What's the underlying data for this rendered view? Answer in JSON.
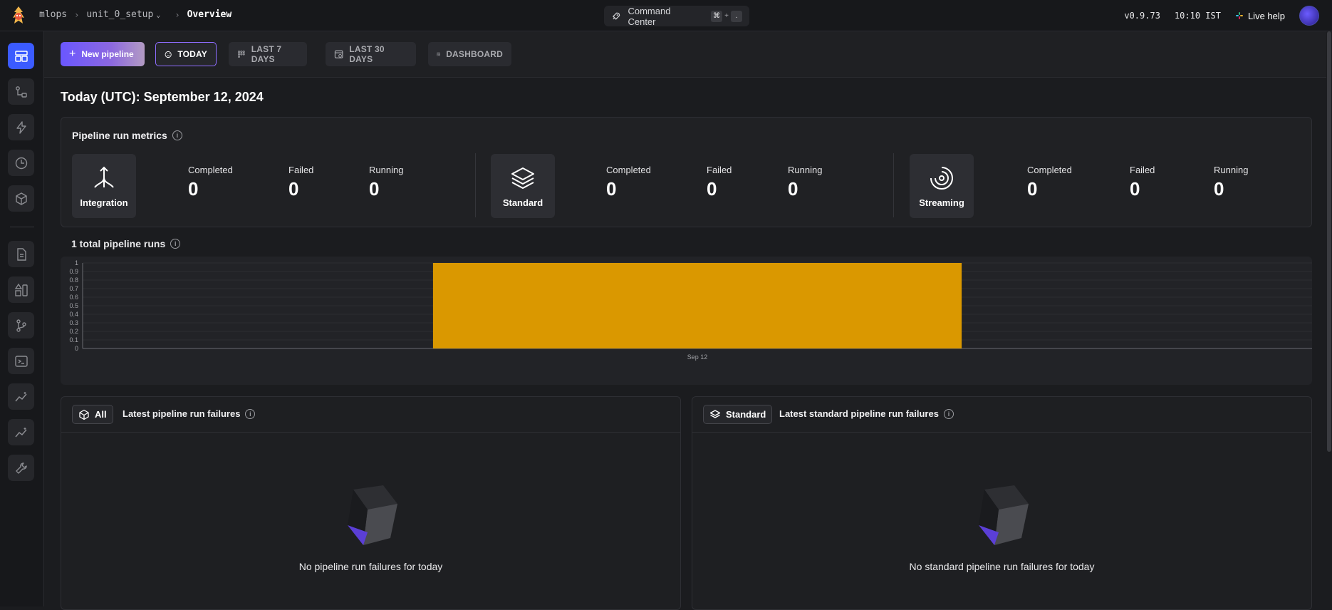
{
  "breadcrumb": {
    "project": "mlops",
    "file": "unit_0_setup",
    "page": "Overview"
  },
  "command_center": {
    "label": "Command Center",
    "key1": "⌘",
    "plus": "+",
    "key2": "."
  },
  "top_right": {
    "version": "v0.9.73",
    "time": "10:10 IST",
    "live_help": "Live help"
  },
  "toolbar": {
    "new_pipeline": "New pipeline",
    "today": "TODAY",
    "last7": "LAST 7 DAYS",
    "last30": "LAST 30 DAYS",
    "dashboard": "DASHBOARD"
  },
  "page_title": "Today (UTC): September 12, 2024",
  "metrics": {
    "title": "Pipeline run metrics",
    "groups": [
      {
        "type": "Integration",
        "completed_label": "Completed",
        "completed": "0",
        "failed_label": "Failed",
        "failed": "0",
        "running_label": "Running",
        "running": "0"
      },
      {
        "type": "Standard",
        "completed_label": "Completed",
        "completed": "0",
        "failed_label": "Failed",
        "failed": "0",
        "running_label": "Running",
        "running": "0"
      },
      {
        "type": "Streaming",
        "completed_label": "Completed",
        "completed": "0",
        "failed_label": "Failed",
        "failed": "0",
        "running_label": "Running",
        "running": "0"
      }
    ]
  },
  "runs_chart": {
    "title": "1 total pipeline runs"
  },
  "chart_data": {
    "type": "bar",
    "categories": [
      "Sep 12"
    ],
    "values": [
      1
    ],
    "title": "",
    "xlabel": "",
    "ylabel": "",
    "ylim": [
      0,
      1
    ],
    "yticks": [
      "0",
      "0.1",
      "0.2",
      "0.3",
      "0.4",
      "0.5",
      "0.6",
      "0.7",
      "0.8",
      "0.9",
      "1"
    ],
    "grid": true,
    "bar_color": "#da9800"
  },
  "failures": {
    "all": {
      "chip": "All",
      "title": "Latest pipeline run failures",
      "empty": "No pipeline run failures for today"
    },
    "standard": {
      "chip": "Standard",
      "title": "Latest standard pipeline run failures",
      "empty": "No standard pipeline run failures for today"
    }
  },
  "colors": {
    "accent": "#3b5bff",
    "bar": "#da9800",
    "selected_border": "#8e6dff"
  }
}
